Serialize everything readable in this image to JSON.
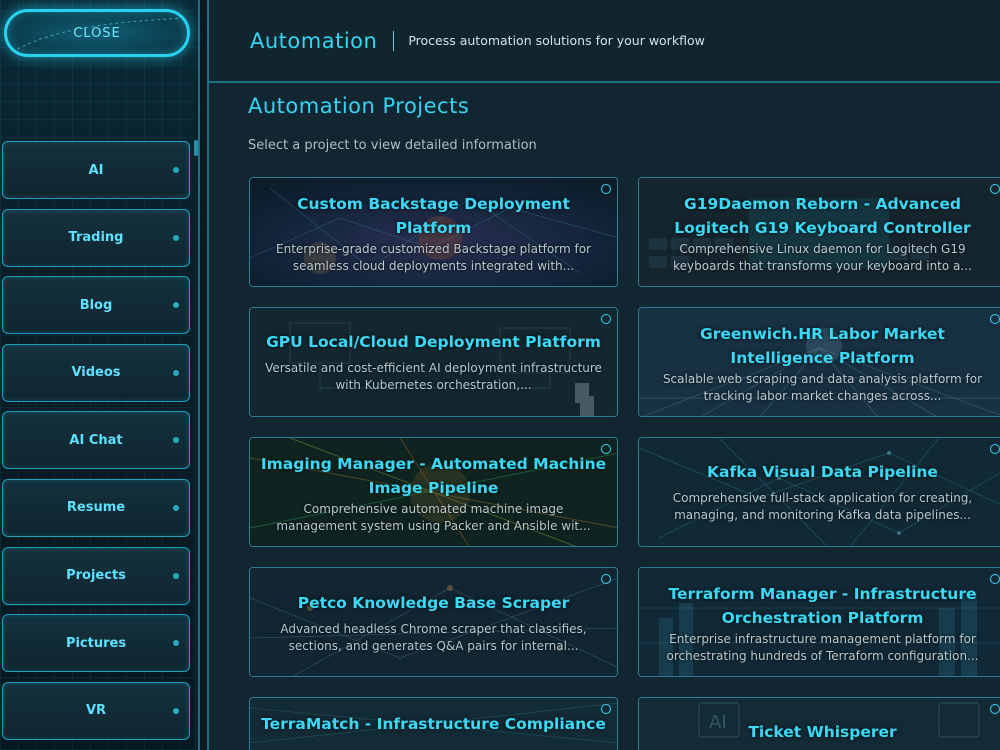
{
  "sidebar": {
    "close_label": "CLOSE",
    "items": [
      {
        "label": "AI"
      },
      {
        "label": "Trading"
      },
      {
        "label": "Blog"
      },
      {
        "label": "Videos"
      },
      {
        "label": "AI Chat"
      },
      {
        "label": "Resume"
      },
      {
        "label": "Projects"
      },
      {
        "label": "Pictures"
      },
      {
        "label": "VR"
      }
    ]
  },
  "header": {
    "title": "Automation",
    "subtitle": "Process automation solutions for your workflow"
  },
  "main": {
    "section_title": "Automation Projects",
    "section_subtitle": "Select a project to view detailed information",
    "cards": [
      {
        "title": "Custom Backstage Deployment Platform",
        "description": "Enterprise-grade customized Backstage platform for seamless cloud deployments integrated with..."
      },
      {
        "title": "G19Daemon Reborn - Advanced Logitech G19 Keyboard Controller",
        "description": "Comprehensive Linux daemon for Logitech G19 keyboards that transforms your keyboard into a..."
      },
      {
        "title": "GPU Local/Cloud Deployment Platform",
        "description": "Versatile and cost-efficient AI deployment infrastructure with Kubernetes orchestration,..."
      },
      {
        "title": "Greenwich.HR Labor Market Intelligence Platform",
        "description": "Scalable web scraping and data analysis platform for tracking labor market changes across..."
      },
      {
        "title": "Imaging Manager - Automated Machine Image Pipeline",
        "description": "Comprehensive automated machine image management system using Packer and Ansible wit..."
      },
      {
        "title": "Kafka Visual Data Pipeline",
        "description": "Comprehensive full-stack application for creating, managing, and monitoring Kafka data pipelines..."
      },
      {
        "title": "Petco Knowledge Base Scraper",
        "description": "Advanced headless Chrome scraper that classifies, sections, and generates Q&A pairs for internal..."
      },
      {
        "title": "Terraform Manager - Infrastructure Orchestration Platform",
        "description": "Enterprise infrastructure management platform for orchestrating hundreds of Terraform configuration..."
      },
      {
        "title": "TerraMatch - Infrastructure Compliance",
        "description": ""
      },
      {
        "title": "Ticket Whisperer",
        "description": ""
      }
    ]
  },
  "colors": {
    "accent": "#34d5f2",
    "sidebar_border": "#1e9fbc",
    "background": "#112630"
  },
  "icons": {
    "close": "close-icon",
    "nav_dot": "dot-icon",
    "card_marker": "ring-icon"
  }
}
